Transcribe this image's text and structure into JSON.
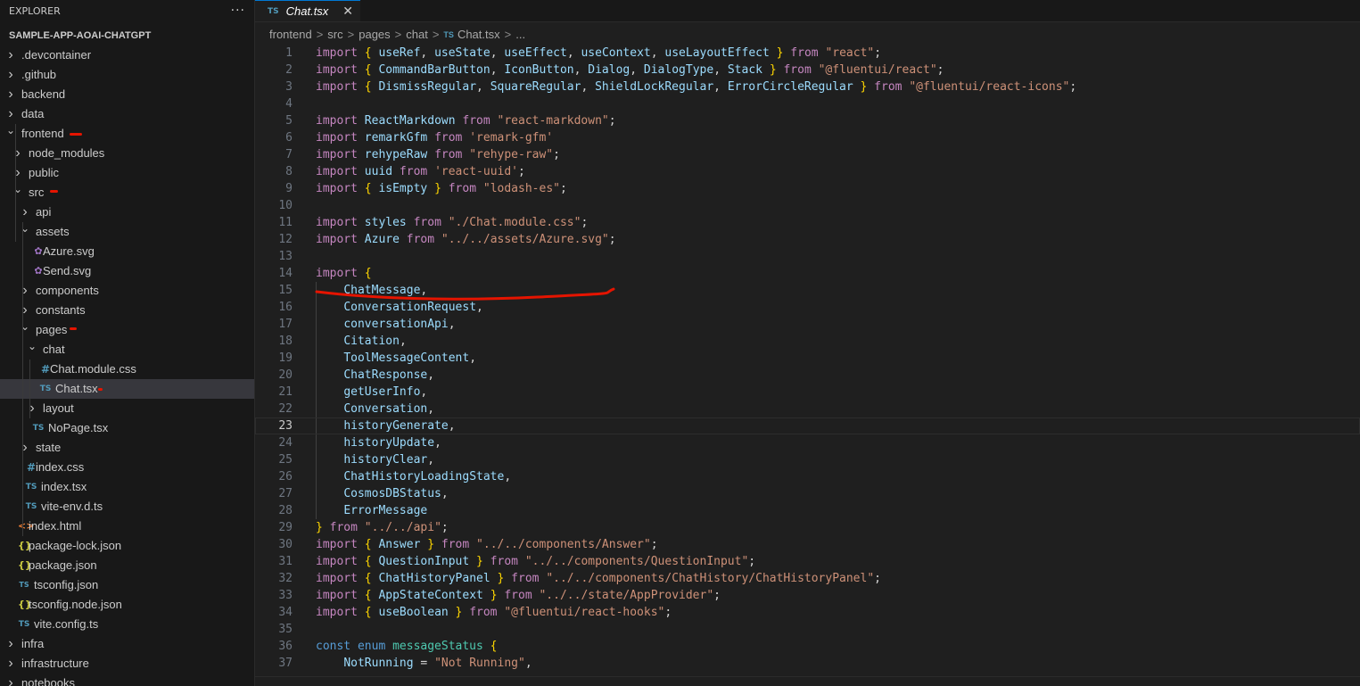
{
  "explorer": {
    "title": "EXPLORER",
    "more_label": "···",
    "tree": [
      {
        "label": "SAMPLE-APP-AOAI-CHATGPT",
        "depth": 0,
        "kind": "root",
        "chevron": "open"
      },
      {
        "label": ".devcontainer",
        "depth": 1,
        "kind": "folder",
        "chevron": "closed"
      },
      {
        "label": ".github",
        "depth": 1,
        "kind": "folder",
        "chevron": "closed"
      },
      {
        "label": "backend",
        "depth": 1,
        "kind": "folder",
        "chevron": "closed"
      },
      {
        "label": "data",
        "depth": 1,
        "kind": "folder",
        "chevron": "closed"
      },
      {
        "label": "frontend",
        "depth": 1,
        "kind": "folder",
        "chevron": "open"
      },
      {
        "label": "node_modules",
        "depth": 2,
        "kind": "folder",
        "chevron": "closed"
      },
      {
        "label": "public",
        "depth": 2,
        "kind": "folder",
        "chevron": "closed"
      },
      {
        "label": "src",
        "depth": 2,
        "kind": "folder",
        "chevron": "open"
      },
      {
        "label": "api",
        "depth": 3,
        "kind": "folder",
        "chevron": "closed"
      },
      {
        "label": "assets",
        "depth": 3,
        "kind": "folder",
        "chevron": "open"
      },
      {
        "label": "Azure.svg",
        "depth": 4,
        "kind": "file",
        "icon": "svg"
      },
      {
        "label": "Send.svg",
        "depth": 4,
        "kind": "file",
        "icon": "svg"
      },
      {
        "label": "components",
        "depth": 3,
        "kind": "folder",
        "chevron": "closed"
      },
      {
        "label": "constants",
        "depth": 3,
        "kind": "folder",
        "chevron": "closed"
      },
      {
        "label": "pages",
        "depth": 3,
        "kind": "folder",
        "chevron": "open"
      },
      {
        "label": "chat",
        "depth": 4,
        "kind": "folder",
        "chevron": "open"
      },
      {
        "label": "Chat.module.css",
        "depth": 5,
        "kind": "file",
        "icon": "css"
      },
      {
        "label": "Chat.tsx",
        "depth": 5,
        "kind": "file",
        "icon": "ts",
        "selected": true
      },
      {
        "label": "layout",
        "depth": 4,
        "kind": "folder",
        "chevron": "closed"
      },
      {
        "label": "NoPage.tsx",
        "depth": 4,
        "kind": "file",
        "icon": "ts"
      },
      {
        "label": "state",
        "depth": 3,
        "kind": "folder",
        "chevron": "closed"
      },
      {
        "label": "index.css",
        "depth": 3,
        "kind": "file",
        "icon": "css"
      },
      {
        "label": "index.tsx",
        "depth": 3,
        "kind": "file",
        "icon": "ts"
      },
      {
        "label": "vite-env.d.ts",
        "depth": 3,
        "kind": "file",
        "icon": "ts"
      },
      {
        "label": "index.html",
        "depth": 2,
        "kind": "file",
        "icon": "html"
      },
      {
        "label": "package-lock.json",
        "depth": 2,
        "kind": "file",
        "icon": "json"
      },
      {
        "label": "package.json",
        "depth": 2,
        "kind": "file",
        "icon": "json"
      },
      {
        "label": "tsconfig.json",
        "depth": 2,
        "kind": "file",
        "icon": "tsconfig"
      },
      {
        "label": "tsconfig.node.json",
        "depth": 2,
        "kind": "file",
        "icon": "json"
      },
      {
        "label": "vite.config.ts",
        "depth": 2,
        "kind": "file",
        "icon": "ts"
      },
      {
        "label": "infra",
        "depth": 1,
        "kind": "folder",
        "chevron": "closed"
      },
      {
        "label": "infrastructure",
        "depth": 1,
        "kind": "folder",
        "chevron": "closed"
      },
      {
        "label": "notebooks",
        "depth": 1,
        "kind": "folder",
        "chevron": "closed"
      }
    ]
  },
  "file_icons": {
    "ts": "TS",
    "css": "#",
    "json": "{}",
    "html": "<>",
    "svg": "✿",
    "tsconfig": "TS"
  },
  "tab": {
    "icon": "TS",
    "label": "Chat.tsx",
    "close": "✕"
  },
  "breadcrumb": {
    "parts": [
      "frontend",
      "src",
      "pages",
      "chat"
    ],
    "file_icon": "TS",
    "file": "Chat.tsx",
    "tail": "...",
    "separator": ">"
  },
  "editor": {
    "current_line": 23,
    "lines": [
      [
        [
          "kw",
          "import "
        ],
        [
          "br",
          "{ "
        ],
        [
          "id",
          "useRef"
        ],
        [
          "pn",
          ", "
        ],
        [
          "id",
          "useState"
        ],
        [
          "pn",
          ", "
        ],
        [
          "id",
          "useEffect"
        ],
        [
          "pn",
          ", "
        ],
        [
          "id",
          "useContext"
        ],
        [
          "pn",
          ", "
        ],
        [
          "id",
          "useLayoutEffect "
        ],
        [
          "br",
          "}"
        ],
        [
          "kw",
          " from "
        ],
        [
          "str",
          "\"react\""
        ],
        [
          "pn",
          ";"
        ]
      ],
      [
        [
          "kw",
          "import "
        ],
        [
          "br",
          "{ "
        ],
        [
          "id",
          "CommandBarButton"
        ],
        [
          "pn",
          ", "
        ],
        [
          "id",
          "IconButton"
        ],
        [
          "pn",
          ", "
        ],
        [
          "id",
          "Dialog"
        ],
        [
          "pn",
          ", "
        ],
        [
          "id",
          "DialogType"
        ],
        [
          "pn",
          ", "
        ],
        [
          "id",
          "Stack "
        ],
        [
          "br",
          "}"
        ],
        [
          "kw",
          " from "
        ],
        [
          "str",
          "\"@fluentui/react\""
        ],
        [
          "pn",
          ";"
        ]
      ],
      [
        [
          "kw",
          "import "
        ],
        [
          "br",
          "{ "
        ],
        [
          "id",
          "DismissRegular"
        ],
        [
          "pn",
          ", "
        ],
        [
          "id",
          "SquareRegular"
        ],
        [
          "pn",
          ", "
        ],
        [
          "id",
          "ShieldLockRegular"
        ],
        [
          "pn",
          ", "
        ],
        [
          "id",
          "ErrorCircleRegular "
        ],
        [
          "br",
          "}"
        ],
        [
          "kw",
          " from "
        ],
        [
          "str",
          "\"@fluentui/react-icons\""
        ],
        [
          "pn",
          ";"
        ]
      ],
      [],
      [
        [
          "kw",
          "import "
        ],
        [
          "id",
          "ReactMarkdown"
        ],
        [
          "kw",
          " from "
        ],
        [
          "str",
          "\"react-markdown\""
        ],
        [
          "pn",
          ";"
        ]
      ],
      [
        [
          "kw",
          "import "
        ],
        [
          "id",
          "remarkGfm"
        ],
        [
          "kw",
          " from "
        ],
        [
          "str",
          "'remark-gfm'"
        ]
      ],
      [
        [
          "kw",
          "import "
        ],
        [
          "id",
          "rehypeRaw"
        ],
        [
          "kw",
          " from "
        ],
        [
          "str",
          "\"rehype-raw\""
        ],
        [
          "pn",
          ";"
        ]
      ],
      [
        [
          "kw",
          "import "
        ],
        [
          "id",
          "uuid"
        ],
        [
          "kw",
          " from "
        ],
        [
          "str",
          "'react-uuid'"
        ],
        [
          "pn",
          ";"
        ]
      ],
      [
        [
          "kw",
          "import "
        ],
        [
          "br",
          "{ "
        ],
        [
          "id",
          "isEmpty "
        ],
        [
          "br",
          "}"
        ],
        [
          "kw",
          " from "
        ],
        [
          "str",
          "\"lodash-es\""
        ],
        [
          "pn",
          ";"
        ]
      ],
      [],
      [
        [
          "kw",
          "import "
        ],
        [
          "id",
          "styles"
        ],
        [
          "kw",
          " from "
        ],
        [
          "str",
          "\"./Chat.module.css\""
        ],
        [
          "pn",
          ";"
        ]
      ],
      [
        [
          "kw",
          "import "
        ],
        [
          "id",
          "Azure"
        ],
        [
          "kw",
          " from "
        ],
        [
          "str",
          "\"../../assets/Azure.svg\""
        ],
        [
          "pn",
          ";"
        ]
      ],
      [],
      [
        [
          "kw",
          "import "
        ],
        [
          "br",
          "{"
        ]
      ],
      [
        [
          "pn",
          "    "
        ],
        [
          "id",
          "ChatMessage"
        ],
        [
          "pn",
          ","
        ]
      ],
      [
        [
          "pn",
          "    "
        ],
        [
          "id",
          "ConversationRequest"
        ],
        [
          "pn",
          ","
        ]
      ],
      [
        [
          "pn",
          "    "
        ],
        [
          "id",
          "conversationApi"
        ],
        [
          "pn",
          ","
        ]
      ],
      [
        [
          "pn",
          "    "
        ],
        [
          "id",
          "Citation"
        ],
        [
          "pn",
          ","
        ]
      ],
      [
        [
          "pn",
          "    "
        ],
        [
          "id",
          "ToolMessageContent"
        ],
        [
          "pn",
          ","
        ]
      ],
      [
        [
          "pn",
          "    "
        ],
        [
          "id",
          "ChatResponse"
        ],
        [
          "pn",
          ","
        ]
      ],
      [
        [
          "pn",
          "    "
        ],
        [
          "id",
          "getUserInfo"
        ],
        [
          "pn",
          ","
        ]
      ],
      [
        [
          "pn",
          "    "
        ],
        [
          "id",
          "Conversation"
        ],
        [
          "pn",
          ","
        ]
      ],
      [
        [
          "pn",
          "    "
        ],
        [
          "id",
          "historyGenerate"
        ],
        [
          "pn",
          ","
        ]
      ],
      [
        [
          "pn",
          "    "
        ],
        [
          "id",
          "historyUpdate"
        ],
        [
          "pn",
          ","
        ]
      ],
      [
        [
          "pn",
          "    "
        ],
        [
          "id",
          "historyClear"
        ],
        [
          "pn",
          ","
        ]
      ],
      [
        [
          "pn",
          "    "
        ],
        [
          "id",
          "ChatHistoryLoadingState"
        ],
        [
          "pn",
          ","
        ]
      ],
      [
        [
          "pn",
          "    "
        ],
        [
          "id",
          "CosmosDBStatus"
        ],
        [
          "pn",
          ","
        ]
      ],
      [
        [
          "pn",
          "    "
        ],
        [
          "id",
          "ErrorMessage"
        ]
      ],
      [
        [
          "br",
          "}"
        ],
        [
          "kw",
          " from "
        ],
        [
          "str",
          "\"../../api\""
        ],
        [
          "pn",
          ";"
        ]
      ],
      [
        [
          "kw",
          "import "
        ],
        [
          "br",
          "{ "
        ],
        [
          "id",
          "Answer "
        ],
        [
          "br",
          "}"
        ],
        [
          "kw",
          " from "
        ],
        [
          "str",
          "\"../../components/Answer\""
        ],
        [
          "pn",
          ";"
        ]
      ],
      [
        [
          "kw",
          "import "
        ],
        [
          "br",
          "{ "
        ],
        [
          "id",
          "QuestionInput "
        ],
        [
          "br",
          "}"
        ],
        [
          "kw",
          " from "
        ],
        [
          "str",
          "\"../../components/QuestionInput\""
        ],
        [
          "pn",
          ";"
        ]
      ],
      [
        [
          "kw",
          "import "
        ],
        [
          "br",
          "{ "
        ],
        [
          "id",
          "ChatHistoryPanel "
        ],
        [
          "br",
          "}"
        ],
        [
          "kw",
          " from "
        ],
        [
          "str",
          "\"../../components/ChatHistory/ChatHistoryPanel\""
        ],
        [
          "pn",
          ";"
        ]
      ],
      [
        [
          "kw",
          "import "
        ],
        [
          "br",
          "{ "
        ],
        [
          "id",
          "AppStateContext "
        ],
        [
          "br",
          "}"
        ],
        [
          "kw",
          " from "
        ],
        [
          "str",
          "\"../../state/AppProvider\""
        ],
        [
          "pn",
          ";"
        ]
      ],
      [
        [
          "kw",
          "import "
        ],
        [
          "br",
          "{ "
        ],
        [
          "id",
          "useBoolean "
        ],
        [
          "br",
          "}"
        ],
        [
          "kw",
          " from "
        ],
        [
          "str",
          "\"@fluentui/react-hooks\""
        ],
        [
          "pn",
          ";"
        ]
      ],
      [],
      [
        [
          "kwb",
          "const enum "
        ],
        [
          "ty",
          "messageStatus "
        ],
        [
          "br",
          "{"
        ]
      ],
      [
        [
          "pn",
          "    "
        ],
        [
          "id",
          "NotRunning"
        ],
        [
          "pn",
          " = "
        ],
        [
          "str",
          "\"Not Running\""
        ],
        [
          "pn",
          ","
        ]
      ]
    ]
  },
  "colors": {
    "accent": "#0078d4",
    "annotation": "#e51400"
  }
}
